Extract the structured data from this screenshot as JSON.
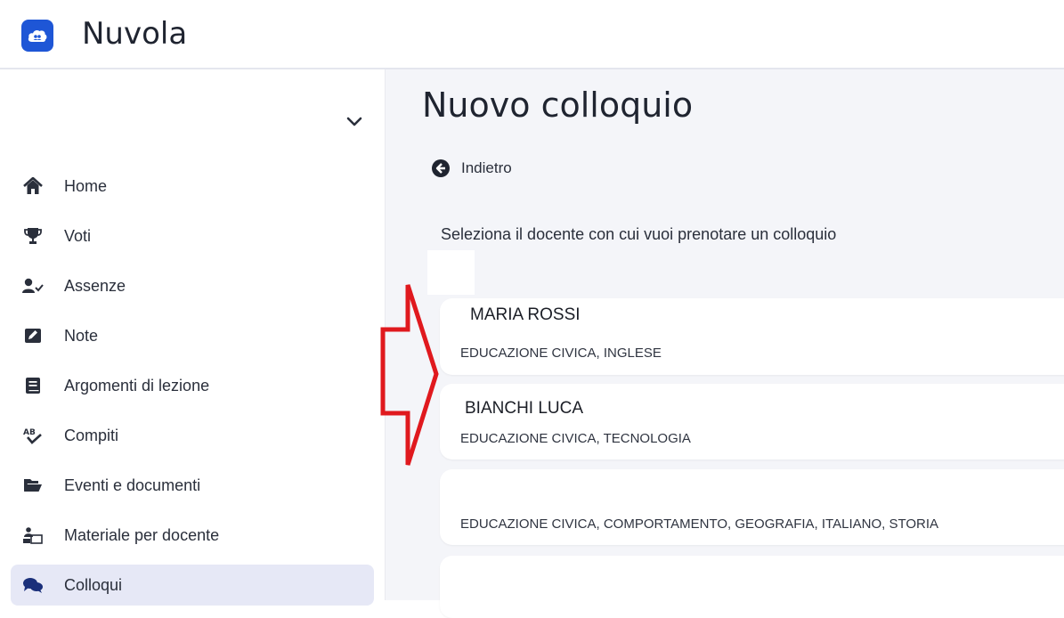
{
  "app": {
    "title": "Nuvola",
    "brand_color": "#1e56d6"
  },
  "sidebar": {
    "items": [
      {
        "label": "Home",
        "icon": "home-icon"
      },
      {
        "label": "Voti",
        "icon": "trophy-icon"
      },
      {
        "label": "Assenze",
        "icon": "user-check-icon"
      },
      {
        "label": "Note",
        "icon": "note-icon"
      },
      {
        "label": "Argomenti di lezione",
        "icon": "book-icon"
      },
      {
        "label": "Compiti",
        "icon": "spellcheck-icon"
      },
      {
        "label": "Eventi e documenti",
        "icon": "folder-open-icon"
      },
      {
        "label": "Materiale per docente",
        "icon": "people-share-icon"
      },
      {
        "label": "Colloqui",
        "icon": "comments-icon",
        "active": true
      }
    ]
  },
  "main": {
    "title": "Nuovo colloquio",
    "back_label": "Indietro",
    "instruction": "Seleziona il docente con cui vuoi prenotare un colloquio",
    "teachers": [
      {
        "name": "MARIA ROSSI",
        "subjects": "EDUCAZIONE CIVICA, INGLESE"
      },
      {
        "name": "BIANCHI LUCA",
        "subjects": "EDUCAZIONE CIVICA, TECNOLOGIA"
      },
      {
        "name": "",
        "subjects": "EDUCAZIONE CIVICA, COMPORTAMENTO, GEOGRAFIA, ITALIANO, STORIA"
      },
      {
        "name": "",
        "subjects": ""
      }
    ]
  },
  "annotation": {
    "color": "#e0191e"
  }
}
